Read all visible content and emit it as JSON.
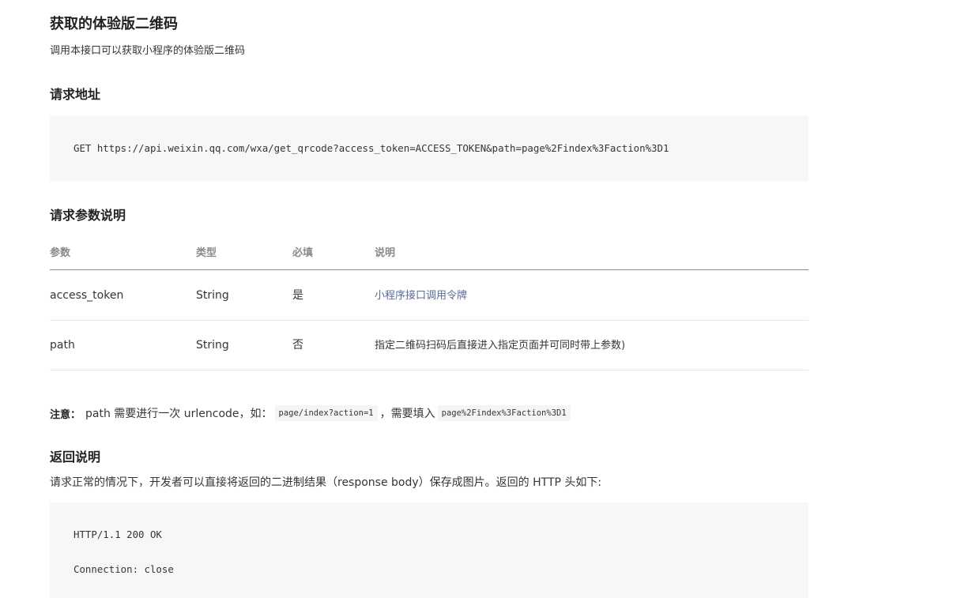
{
  "page": {
    "title": "获取的体验版二维码",
    "description": "调用本接口可以获取小程序的体验版二维码"
  },
  "request_url": {
    "heading": "请求地址",
    "code": "GET https://api.weixin.qq.com/wxa/get_qrcode?access_token=ACCESS_TOKEN&path=page%2Findex%3Faction%3D1"
  },
  "params": {
    "heading": "请求参数说明",
    "columns": [
      "参数",
      "类型",
      "必填",
      "说明"
    ],
    "rows": [
      {
        "name": "access_token",
        "type": "String",
        "required": "是",
        "desc": "小程序接口调用令牌"
      },
      {
        "name": "path",
        "type": "String",
        "required": "否",
        "desc": "指定二维码扫码后直接进入指定页面并可同时带上参数)"
      }
    ]
  },
  "note": {
    "label": "注意：",
    "text1": "path 需要进行一次 urlencode，如：",
    "code1": "page/index?action=1",
    "text2": "，需要填入",
    "code2": "page%2Findex%3Faction%3D1"
  },
  "response": {
    "heading": "返回说明",
    "description": "请求正常的情况下，开发者可以直接将返回的二进制结果（response body）保存成图片。返回的 HTTP 头如下:",
    "code_lines": [
      "HTTP/1.1 200 OK",
      "Connection: close"
    ]
  },
  "colors": {
    "link": "#576b95",
    "code_bg": "#f7f7f7",
    "header_text": "#8a8a8a"
  }
}
